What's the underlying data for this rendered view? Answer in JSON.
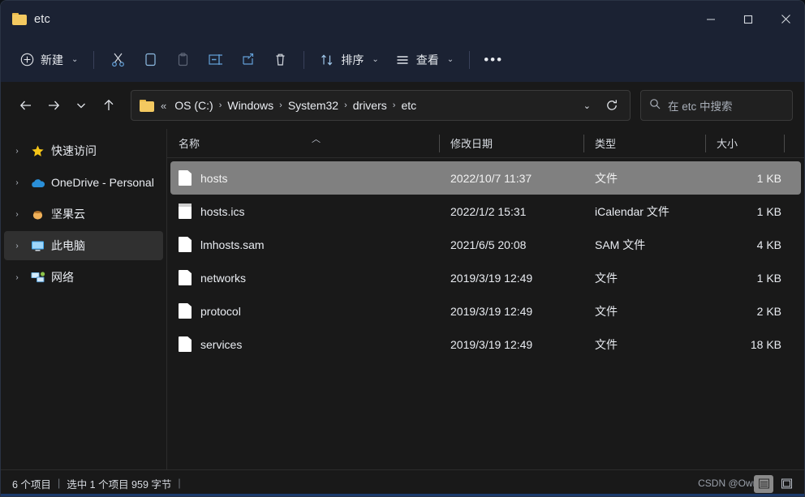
{
  "window": {
    "title": "etc",
    "folder_icon": "folder-icon",
    "controls": {
      "minimize": "minimize-icon",
      "maximize": "maximize-icon",
      "close": "close-icon"
    }
  },
  "toolbar": {
    "new_label": "新建",
    "cut_label": "剪切",
    "copy_label": "复制",
    "paste_label": "粘贴",
    "rename_label": "重命名",
    "share_label": "共享",
    "delete_label": "删除",
    "sort_label": "排序",
    "view_label": "查看",
    "more_label": "…",
    "icons": {
      "new": "plus-circle-icon",
      "cut": "scissors-icon",
      "copy": "copy-icon",
      "paste": "clipboard-icon",
      "rename": "rename-icon",
      "share": "share-icon",
      "delete": "trash-icon",
      "sort": "sort-arrows-icon",
      "view": "list-lines-icon",
      "more": "ellipsis-icon",
      "chevron": "chevron-down-icon"
    }
  },
  "navigation": {
    "back": "back-arrow-icon",
    "forward": "forward-arrow-icon",
    "recent": "chevron-down-icon",
    "up": "up-arrow-icon",
    "refresh": "refresh-icon",
    "breadcrumb_icon": "folder-icon",
    "breadcrumb_overflow": "«",
    "breadcrumb": [
      "OS (C:)",
      "Windows",
      "System32",
      "drivers",
      "etc"
    ],
    "breadcrumb_separator": "›",
    "dropdown": "chevron-down-icon"
  },
  "search": {
    "icon": "search-icon",
    "placeholder": "在 etc 中搜索",
    "value": ""
  },
  "sidebar": {
    "items": [
      {
        "label": "快速访问",
        "icon": "star-icon",
        "selected": false
      },
      {
        "label": "OneDrive - Personal",
        "icon": "cloud-icon",
        "selected": false
      },
      {
        "label": "坚果云",
        "icon": "nut-icon",
        "selected": false
      },
      {
        "label": "此电脑",
        "icon": "computer-icon",
        "selected": true
      },
      {
        "label": "网络",
        "icon": "network-icon",
        "selected": false
      }
    ],
    "expand_chevron": "chevron-right-icon"
  },
  "filelist": {
    "columns": [
      {
        "key": "name",
        "label": "名称",
        "sorted": true,
        "sort_caret": "︿"
      },
      {
        "key": "date",
        "label": "修改日期",
        "sorted": false
      },
      {
        "key": "type",
        "label": "类型",
        "sorted": false
      },
      {
        "key": "size",
        "label": "大小",
        "sorted": false
      }
    ],
    "rows": [
      {
        "name": "hosts",
        "date": "2022/10/7 11:37",
        "type": "文件",
        "size": "1 KB",
        "icon": "file-icon",
        "selected": true
      },
      {
        "name": "hosts.ics",
        "date": "2022/1/2 15:31",
        "type": "iCalendar 文件",
        "size": "1 KB",
        "icon": "calendar-file-icon",
        "selected": false
      },
      {
        "name": "lmhosts.sam",
        "date": "2021/6/5 20:08",
        "type": "SAM 文件",
        "size": "4 KB",
        "icon": "file-icon",
        "selected": false
      },
      {
        "name": "networks",
        "date": "2019/3/19 12:49",
        "type": "文件",
        "size": "1 KB",
        "icon": "file-icon",
        "selected": false
      },
      {
        "name": "protocol",
        "date": "2019/3/19 12:49",
        "type": "文件",
        "size": "2 KB",
        "icon": "file-icon",
        "selected": false
      },
      {
        "name": "services",
        "date": "2019/3/19 12:49",
        "type": "文件",
        "size": "18 KB",
        "icon": "file-icon",
        "selected": false
      }
    ]
  },
  "statusbar": {
    "item_count": "6 个项目",
    "separator": "|",
    "selection": "选中 1 个项目  959 字节",
    "trailing_separator": "|",
    "watermark": "CSDN @Owner",
    "view_details_icon": "details-view-icon",
    "view_thumbnails_icon": "large-icons-view-icon"
  },
  "colors": {
    "titlebar_bg": "#1b2233",
    "content_bg": "#191919",
    "selection_bg": "#808080",
    "accent_icon": "#63a0d8",
    "folder_yellow": "#f3c960"
  }
}
